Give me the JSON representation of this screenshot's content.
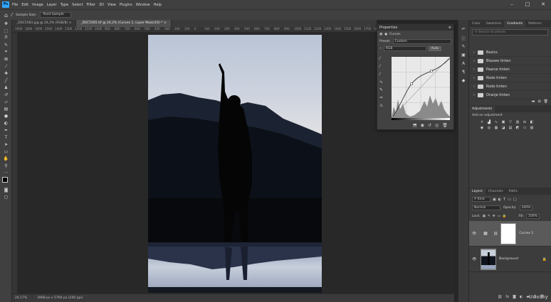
{
  "menu": {
    "logo": "Ps",
    "items": [
      "File",
      "Edit",
      "Image",
      "Layer",
      "Type",
      "Select",
      "Filter",
      "3D",
      "View",
      "Plugins",
      "Window",
      "Help"
    ]
  },
  "window_controls": {
    "minimize": "–",
    "maximize": "□",
    "close": "✕"
  },
  "options_bar": {
    "sample_size_label": "Sample Size:",
    "sample_size_value": "Point Sample"
  },
  "doc_tabs": [
    {
      "label": "_DSC5583.jpg @ 24,2% (RGB/8)",
      "close": "×"
    },
    {
      "label": "_DSC5565.tif @ 24,2% (Curves 1, Layer Mask/16) *",
      "close": "×"
    }
  ],
  "ruler_ticks": [
    "1900",
    "1800",
    "1600",
    "1500",
    "1400",
    "1300",
    "1200",
    "1100",
    "1000",
    "900",
    "800",
    "700",
    "600",
    "500",
    "400",
    "300",
    "200",
    "100",
    "0",
    "100",
    "200",
    "300",
    "400",
    "500",
    "600",
    "700",
    "800",
    "900",
    "1000",
    "1100",
    "1200",
    "1300",
    "1400",
    "1500",
    "1600",
    "1700",
    "1800",
    "1900",
    "2000",
    "2100",
    "2200",
    "2300",
    "2400",
    "2500"
  ],
  "status": {
    "zoom": "24.17%",
    "doc": "3968 px x 5760 px (240 ppi)"
  },
  "properties": {
    "title": "Properties",
    "panel_name": "Curves",
    "preset_label": "Preset:",
    "preset_value": "Custom",
    "channel_value": "RGB",
    "auto_label": "Auto"
  },
  "right_top": {
    "tabs": [
      "Color",
      "Swatches",
      "Gradients",
      "Patterns"
    ],
    "active_tab": "Gradients",
    "search_placeholder": "Search Gradients",
    "groups": [
      "Basics",
      "Blauwe tinten",
      "Paarse tinten",
      "Rode tinten",
      "Rode tinten",
      "Oranje tinten"
    ]
  },
  "adjustments": {
    "title": "Adjustments",
    "subtitle": "Add an adjustment"
  },
  "layers_panel": {
    "tabs": [
      "Layers",
      "Channels",
      "Paths"
    ],
    "active_tab": "Layers",
    "kind_label": "Kind",
    "blend_mode": "Normal",
    "opacity_label": "Opacity:",
    "opacity_value": "100%",
    "lock_label": "Lock:",
    "fill_label": "Fill:",
    "fill_value": "100%",
    "layers": [
      {
        "name": "Curves 1",
        "selected": true
      },
      {
        "name": "Background",
        "selected": false
      }
    ]
  },
  "watermark": "Udemy",
  "colors": {
    "accent": "#31a8ff",
    "panel": "#424242",
    "canvas": "#282828"
  },
  "icons": {
    "move": "move-icon",
    "eyedropper": "eyedropper-icon",
    "home": "home-icon"
  }
}
